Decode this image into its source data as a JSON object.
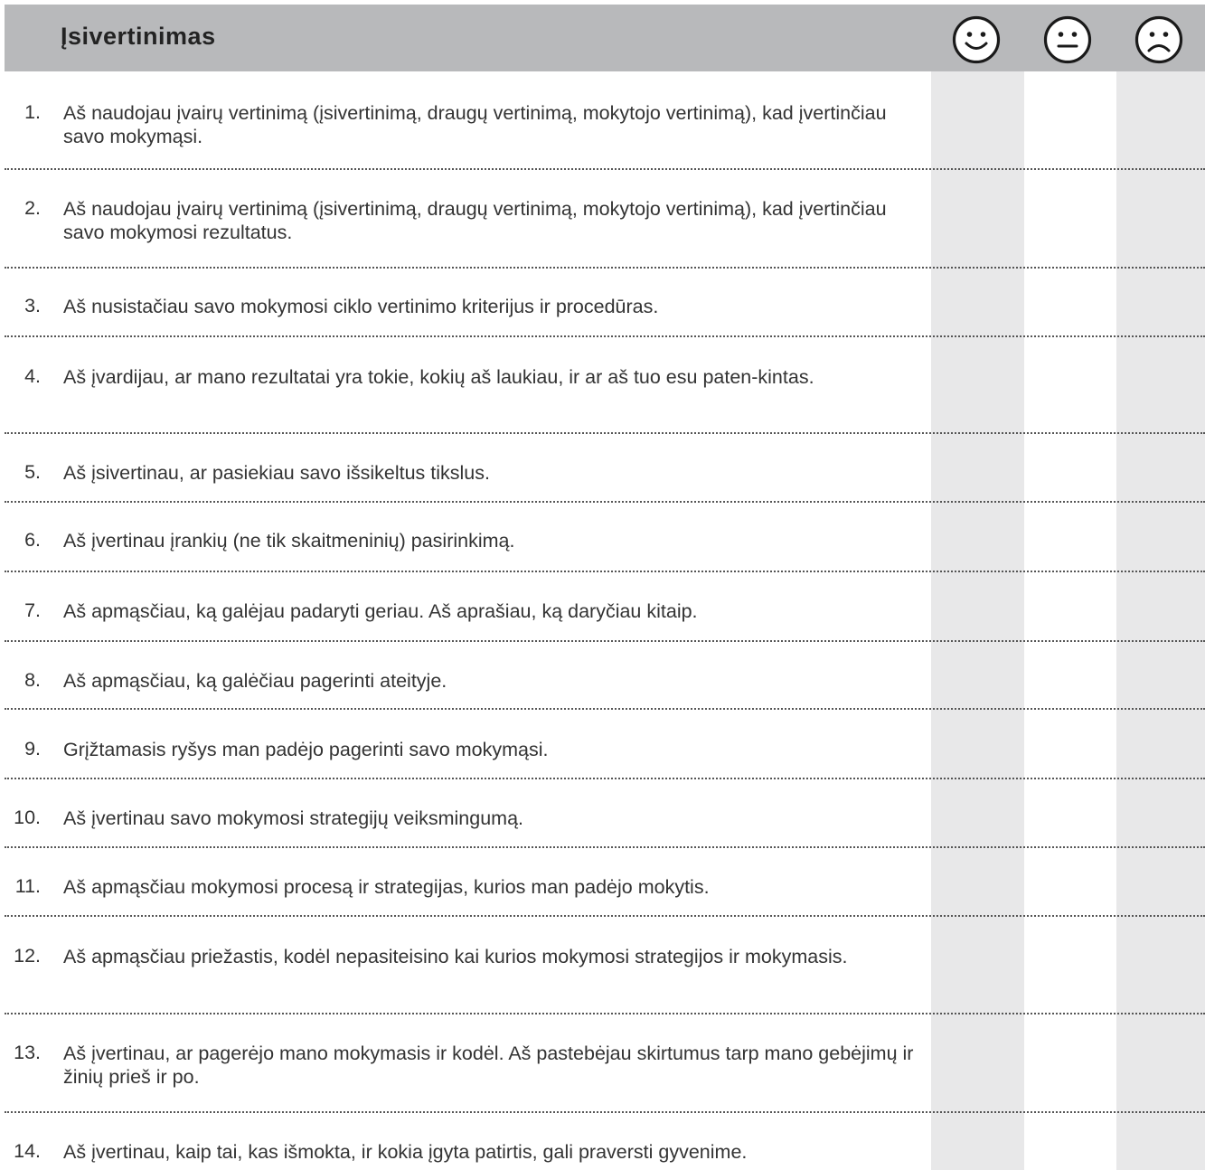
{
  "header": {
    "title": "Įsivertinimas",
    "icons": [
      "smiley-happy-icon",
      "smiley-neutral-icon",
      "smiley-sad-icon"
    ]
  },
  "colors": {
    "header_bg": "#b8b9bb",
    "column_shade": "#e8e8e9",
    "text": "#333333"
  },
  "items": [
    {
      "num": "1.",
      "text": "Aš naudojau įvairų vertinimą (įsivertinimą, draugų vertinimą, mokytojo vertinimą), kad įvertinčiau savo mokymąsi."
    },
    {
      "num": "2.",
      "text": "Aš naudojau įvairų vertinimą (įsivertinimą, draugų vertinimą, mokytojo vertinimą), kad įvertinčiau savo mokymosi rezultatus."
    },
    {
      "num": "3.",
      "text": "Aš nusistačiau savo mokymosi ciklo vertinimo kriterijus ir procedūras."
    },
    {
      "num": "4.",
      "text": "Aš įvardijau, ar mano rezultatai yra tokie, kokių aš laukiau, ir ar aš tuo esu paten-kintas."
    },
    {
      "num": "5.",
      "text": "Aš įsivertinau, ar pasiekiau savo išsikeltus tikslus."
    },
    {
      "num": "6.",
      "text": "Aš įvertinau  įrankių (ne tik skaitmeninių) pasirinkimą."
    },
    {
      "num": "7.",
      "text": "Aš apmąsčiau, ką galėjau padaryti geriau. Aš aprašiau, ką daryčiau kitaip."
    },
    {
      "num": "8.",
      "text": "Aš apmąsčiau, ką galėčiau pagerinti ateityje."
    },
    {
      "num": "9.",
      "text": "Grįžtamasis ryšys man padėjo pagerinti savo mokymąsi."
    },
    {
      "num": "10.",
      "text": "Aš įvertinau savo mokymosi strategijų veiksmingumą."
    },
    {
      "num": "11.",
      "text": "Aš apmąsčiau mokymosi procesą ir strategijas, kurios man padėjo mokytis."
    },
    {
      "num": "12.",
      "text": "Aš apmąsčiau priežastis, kodėl nepasiteisino kai kurios mokymosi strategijos ir mokymasis."
    },
    {
      "num": "13.",
      "text": "Aš įvertinau, ar pagerėjo mano mokymasis ir kodėl. Aš pastebėjau skirtumus tarp mano gebėjimų ir žinių prieš ir po."
    },
    {
      "num": "14.",
      "text": "Aš įvertinau, kaip tai, kas išmokta, ir kokia įgyta patirtis, gali praversti gyvenime."
    }
  ]
}
